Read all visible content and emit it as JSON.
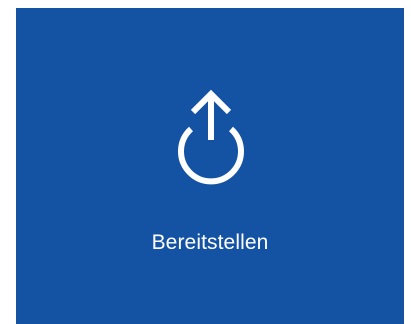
{
  "tile": {
    "label": "Bereitstellen",
    "icon": "power-upload-icon",
    "background_color": "#1453a4",
    "foreground_color": "#ffffff"
  }
}
